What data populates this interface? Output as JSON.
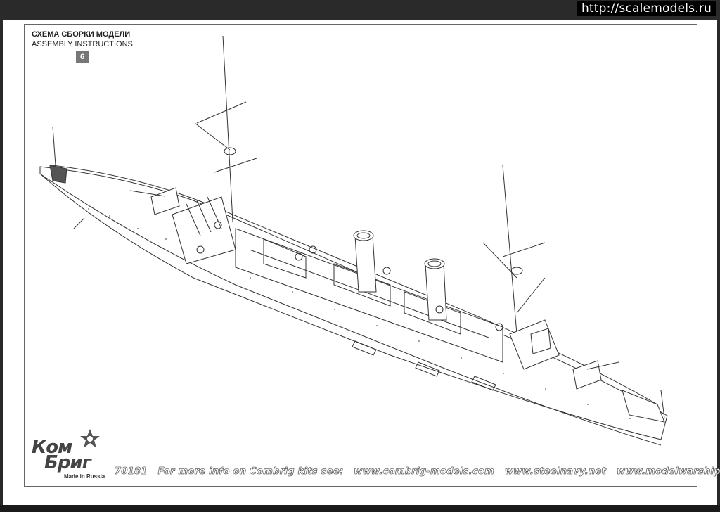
{
  "watermark": "http://scalemodels.ru",
  "header": {
    "title_ru": "СХЕМА СБОРКИ МОДЕЛИ",
    "title_en": "ASSEMBLY INSTRUCTIONS",
    "step": "6"
  },
  "logo": {
    "line1": "Ком",
    "line2": "Бриг",
    "made_in": "Made in Russia"
  },
  "footer": {
    "kit_number": "70181",
    "info_text": "For more info on Combrig kits see:",
    "site1": "www.combrig-models.com",
    "site2": "www.steelnavy.net",
    "site3": "www.modelwarships.com"
  },
  "colors": {
    "line": "#333333",
    "paper": "#ffffff",
    "badge": "#777777",
    "logo_star": "#555555"
  }
}
